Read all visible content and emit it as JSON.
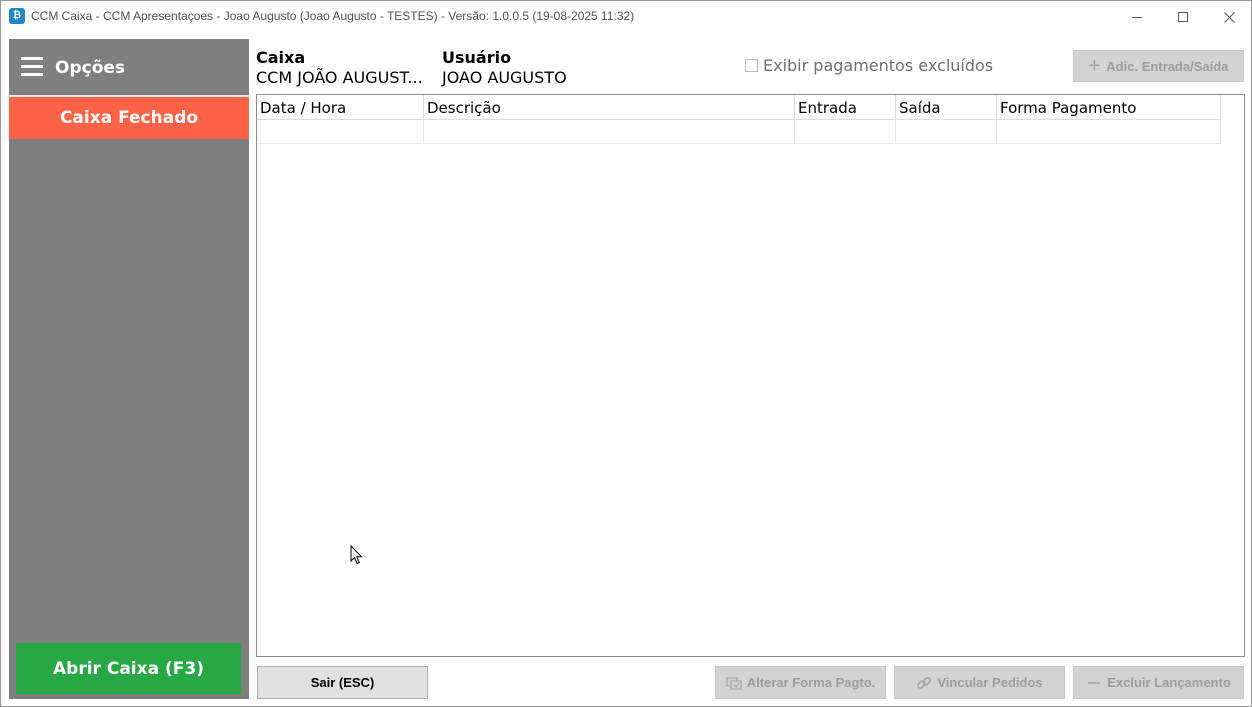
{
  "window": {
    "title": "CCM Caixa - CCM Apresentaçoes - Joao Augusto (Joao Augusto - TESTES) - Versão: 1.0.0.5 (19-08-2025 11:32)",
    "app_icon": "cash-register-icon",
    "app_icon_glyph": "₿"
  },
  "sidebar": {
    "menu_label": "Opções",
    "status": "Caixa Fechado",
    "status_color": "#ff6347",
    "open_button": "Abrir Caixa (F3)",
    "open_button_color": "#28a745"
  },
  "header": {
    "caixa_label": "Caixa",
    "caixa_value": "CCM JOÃO AUGUST...",
    "usuario_label": "Usuário",
    "usuario_value": "JOAO AUGUSTO",
    "show_deleted_label": "Exibir pagamentos excluídos",
    "show_deleted_checked": false,
    "add_button": "Adic. Entrada/Saída"
  },
  "grid": {
    "columns": [
      "Data / Hora",
      "Descrição",
      "Entrada",
      "Saída",
      "Forma Pagamento"
    ],
    "rows": []
  },
  "footer": {
    "exit_button": "Sair (ESC)",
    "change_payment_button": "Alterar Forma Pagto.",
    "link_orders_button": "Vincular Pedidos",
    "delete_entry_button": "Excluir Lançamento"
  }
}
